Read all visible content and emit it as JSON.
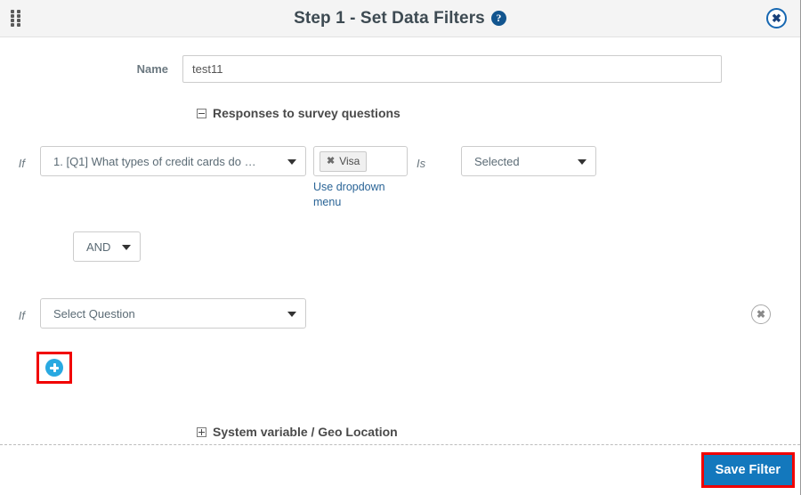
{
  "header": {
    "title": "Step 1 - Set Data Filters",
    "help_icon_glyph": "?",
    "close_icon_glyph": "✖",
    "drag_handle_name": "drag-handle-icon",
    "background_color": "#f4f4f4"
  },
  "form": {
    "name_label": "Name",
    "name_value": "test11",
    "name_placeholder": ""
  },
  "sections": {
    "responses": {
      "title": "Responses to survey questions",
      "expanded": true,
      "toggle_glyph": "minus"
    },
    "system_variable": {
      "title": "System variable / Geo Location",
      "expanded": false,
      "toggle_glyph": "plus"
    }
  },
  "filters": {
    "row1": {
      "if_label": "If",
      "question": "1. [Q1] What types of credit cards do …",
      "tags": [
        {
          "label": "Visa",
          "remove_glyph": "✖"
        }
      ],
      "dropdown_link": "Use dropdown menu",
      "is_label": "Is",
      "condition": "Selected",
      "caret_glyph": "▾"
    },
    "operator": {
      "value": "AND",
      "caret_glyph": "▾"
    },
    "row2": {
      "if_label": "If",
      "question": "Select Question",
      "caret_glyph": "▾",
      "remove_glyph": "✖"
    }
  },
  "add_condition": {
    "icon_name": "add-circle-icon",
    "glyph": "+",
    "highlight_color": "#f10000",
    "icon_color": "#29a9e1"
  },
  "footer": {
    "save_label": "Save Filter",
    "save_color": "#1378bd",
    "highlight_color": "#f10000"
  }
}
